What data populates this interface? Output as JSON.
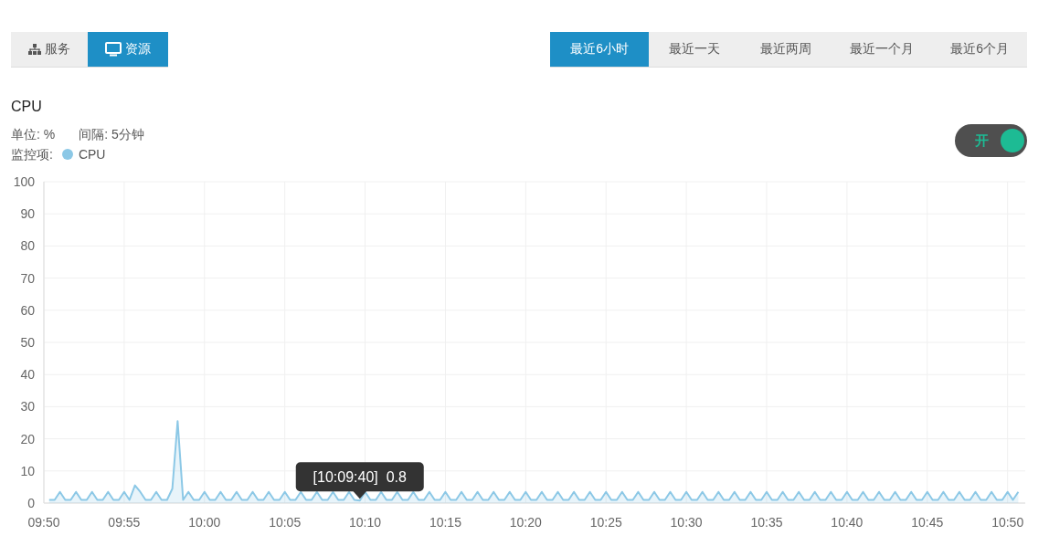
{
  "view_tabs": [
    {
      "label": "服务",
      "selected": false
    },
    {
      "label": "资源",
      "selected": true
    }
  ],
  "range_tabs": [
    {
      "label": "最近6小时",
      "selected": true
    },
    {
      "label": "最近一天",
      "selected": false
    },
    {
      "label": "最近两周",
      "selected": false
    },
    {
      "label": "最近一个月",
      "selected": false
    },
    {
      "label": "最近6个月",
      "selected": false
    }
  ],
  "panel": {
    "title": "CPU",
    "unit": "单位: %",
    "interval": "间隔: 5分钟",
    "legend_label": "监控项:",
    "toggle": {
      "label": "开",
      "on": true
    },
    "chart_data": {
      "type": "area",
      "grid": true,
      "ylim": [
        0,
        100
      ],
      "xlim": [
        590,
        651.1
      ],
      "yticks": [
        0,
        10,
        20,
        30,
        40,
        50,
        60,
        70,
        80,
        90,
        100
      ],
      "xticks": [
        {
          "value": 590,
          "label": "09:50"
        },
        {
          "value": 595,
          "label": "09:55"
        },
        {
          "value": 600,
          "label": "10:00"
        },
        {
          "value": 605,
          "label": "10:05"
        },
        {
          "value": 610,
          "label": "10:10"
        },
        {
          "value": 615,
          "label": "10:15"
        },
        {
          "value": 620,
          "label": "10:20"
        },
        {
          "value": 625,
          "label": "10:25"
        },
        {
          "value": 630,
          "label": "10:30"
        },
        {
          "value": 635,
          "label": "10:35"
        },
        {
          "value": 640,
          "label": "10:40"
        },
        {
          "value": 645,
          "label": "10:45"
        },
        {
          "value": 650,
          "label": "10:50"
        }
      ],
      "x": [
        590.33,
        590.67,
        591,
        591.33,
        591.67,
        592,
        592.33,
        592.67,
        593,
        593.33,
        593.67,
        594,
        594.33,
        594.67,
        595,
        595.33,
        595.67,
        596,
        596.33,
        596.67,
        597,
        597.33,
        597.67,
        598,
        598.33,
        598.67,
        599,
        599.33,
        599.67,
        600,
        600.33,
        600.67,
        601,
        601.33,
        601.67,
        602,
        602.33,
        602.67,
        603,
        603.33,
        603.67,
        604,
        604.33,
        604.67,
        605,
        605.33,
        605.67,
        606,
        606.33,
        606.67,
        607,
        607.33,
        607.67,
        608,
        608.33,
        608.67,
        609,
        609.33,
        609.67,
        610,
        610.33,
        610.67,
        611,
        611.33,
        611.67,
        612,
        612.33,
        612.67,
        613,
        613.33,
        613.67,
        614,
        614.33,
        614.67,
        615,
        615.33,
        615.67,
        616,
        616.33,
        616.67,
        617,
        617.33,
        617.67,
        618,
        618.33,
        618.67,
        619,
        619.33,
        619.67,
        620,
        620.33,
        620.67,
        621,
        621.33,
        621.67,
        622,
        622.33,
        622.67,
        623,
        623.33,
        623.67,
        624,
        624.33,
        624.67,
        625,
        625.33,
        625.67,
        626,
        626.33,
        626.67,
        627,
        627.33,
        627.67,
        628,
        628.33,
        628.67,
        629,
        629.33,
        629.67,
        630,
        630.33,
        630.67,
        631,
        631.33,
        631.67,
        632,
        632.33,
        632.67,
        633,
        633.33,
        633.67,
        634,
        634.33,
        634.67,
        635,
        635.33,
        635.67,
        636,
        636.33,
        636.67,
        637,
        637.33,
        637.67,
        638,
        638.33,
        638.67,
        639,
        639.33,
        639.67,
        640,
        640.33,
        640.67,
        641,
        641.33,
        641.67,
        642,
        642.33,
        642.67,
        643,
        643.33,
        643.67,
        644,
        644.33,
        644.67,
        645,
        645.33,
        645.67,
        646,
        646.33,
        646.67,
        647,
        647.33,
        647.67,
        648,
        648.33,
        648.67,
        649,
        649.33,
        649.67,
        650,
        650.33,
        650.67
      ],
      "series": [
        {
          "name": "CPU",
          "color": "#8cc8e6",
          "values": [
            1,
            1,
            3.5,
            1,
            1,
            3.5,
            1,
            1,
            3.5,
            1,
            1,
            3.5,
            1,
            1,
            3.5,
            1,
            5.5,
            3.5,
            1,
            1,
            3.5,
            1,
            1,
            4.5,
            25.5,
            1,
            3.5,
            1,
            1,
            3.5,
            1,
            1,
            3.5,
            1,
            1,
            3.5,
            1,
            1,
            3.5,
            1,
            1,
            3.5,
            1,
            1,
            3.5,
            1,
            1,
            3.5,
            1,
            1,
            3.5,
            1,
            1,
            3.5,
            1,
            1,
            3.5,
            1,
            0.8,
            3.5,
            1,
            1,
            3.5,
            1,
            1,
            3.5,
            1,
            1,
            3.5,
            1,
            1,
            3.5,
            1,
            1,
            3.5,
            1,
            1,
            3.5,
            1,
            1,
            3.5,
            1,
            1,
            3.5,
            1,
            1,
            3.5,
            1,
            1,
            3.5,
            1,
            1,
            3.5,
            1,
            1,
            3.5,
            1,
            1,
            3.5,
            1,
            1,
            3.5,
            1,
            1,
            3.5,
            1,
            1,
            3.5,
            1,
            1,
            3.5,
            1,
            1,
            3.5,
            1,
            1,
            3.5,
            1,
            1,
            3.5,
            1,
            1,
            3.5,
            1,
            1,
            3.5,
            1,
            1,
            3.5,
            1,
            1,
            3.5,
            1,
            1,
            3.5,
            1,
            1,
            3.5,
            1,
            1,
            3.5,
            1,
            1,
            3.5,
            1,
            1,
            3.5,
            1,
            1,
            3.5,
            1,
            1,
            3.5,
            1,
            1,
            3.5,
            1,
            1,
            3.5,
            1,
            1,
            3.5,
            1,
            1,
            3.5,
            1,
            1,
            3.5,
            1,
            1,
            3.5,
            1,
            1,
            3.5,
            1,
            1,
            3.5,
            1,
            1,
            3.5,
            1,
            3.5
          ]
        }
      ],
      "annotations": [
        {
          "x": 609.67,
          "y": 0.8,
          "text": "[10:09:40]  0.8"
        }
      ]
    }
  }
}
